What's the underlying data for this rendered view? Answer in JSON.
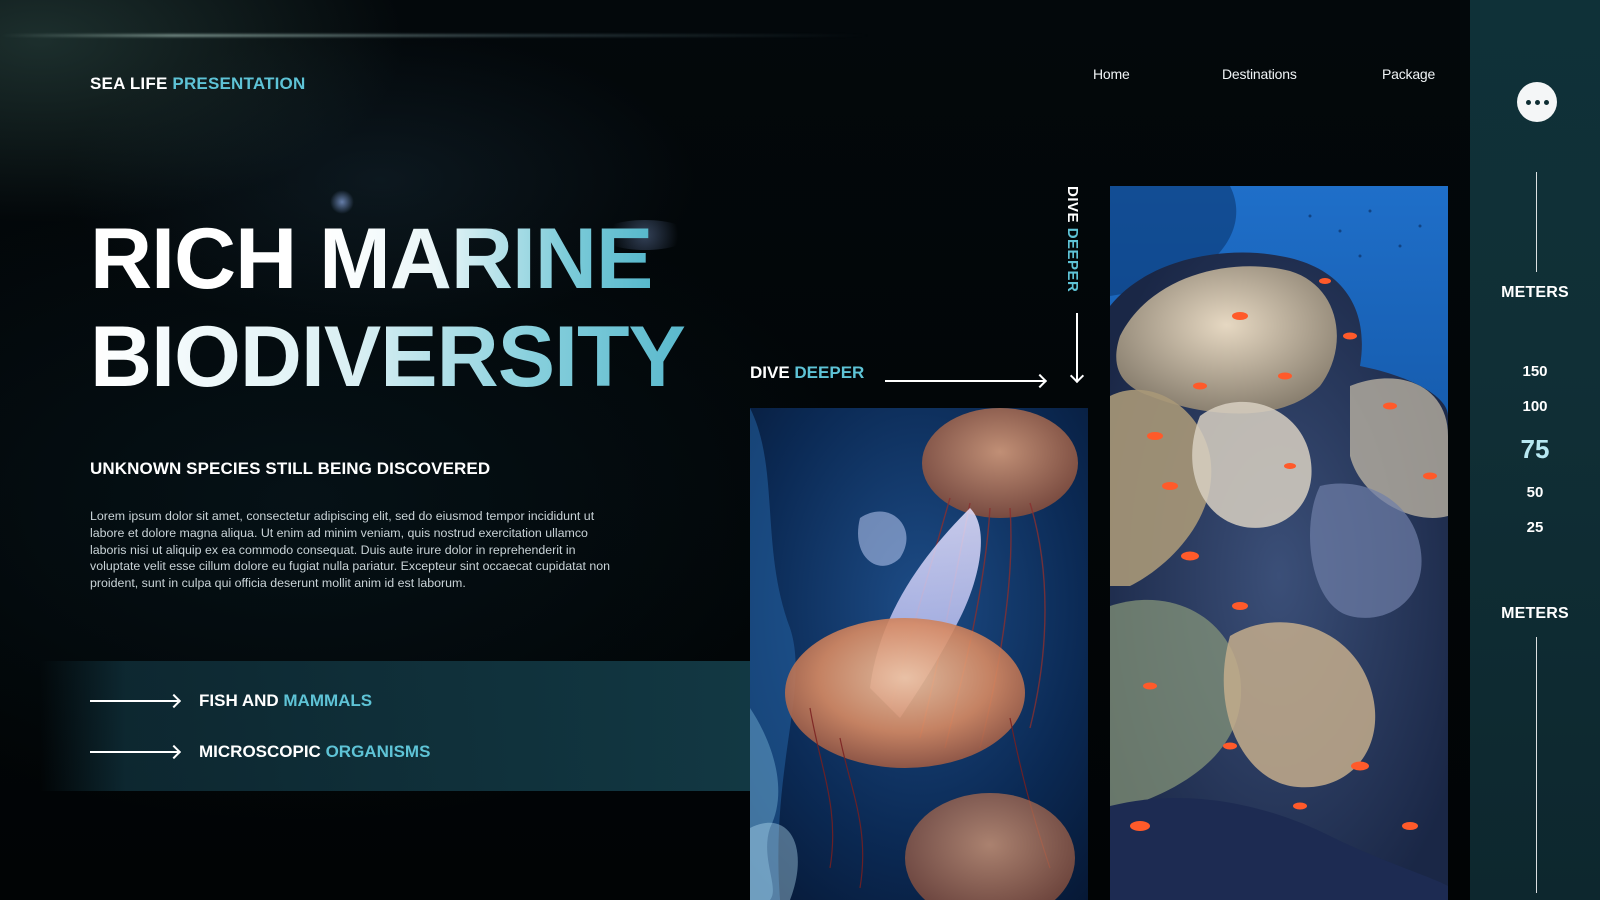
{
  "brand": {
    "part1": "SEA LIFE ",
    "part2": "PRESENTATION"
  },
  "nav": {
    "items": [
      "Home",
      "Destinations",
      "Package"
    ]
  },
  "hero": {
    "line1_a": "RICH ",
    "line1_b": "MARINE",
    "line2": "BIODIVERSITY",
    "subtitle": "UNKNOWN SPECIES STILL BEING DISCOVERED",
    "body": "Lorem ipsum dolor sit amet, consectetur adipiscing elit, sed do eiusmod tempor incididunt ut labore et dolore magna aliqua. Ut enim ad minim veniam, quis nostrud exercitation ullamco laboris nisi ut aliquip ex ea commodo consequat. Duis aute irure dolor in reprehenderit in voluptate velit esse cillum dolore eu fugiat nulla pariatur. Excepteur sint occaecat cupidatat non proident, sunt in culpa qui officia deserunt mollit anim id est laborum."
  },
  "links": [
    {
      "part1": "FISH AND ",
      "part2": "MAMMALS"
    },
    {
      "part1": "MICROSCOPIC ",
      "part2": "ORGANISMS"
    }
  ],
  "dive": {
    "part1": "DIVE ",
    "part2": "DEEPER",
    "vertical_part1": "DIVE ",
    "vertical_part2": "DEEPER"
  },
  "photos": {
    "left": "jellyfish",
    "right": "coral reef with orange fish"
  },
  "sidebar": {
    "menu_icon": "more-horizontal-icon",
    "top_label": "METERS",
    "bottom_label": "METERS",
    "depths": [
      "150",
      "100",
      "75",
      "50",
      "25"
    ],
    "active_depth": "75"
  },
  "colors": {
    "accent": "#5ec3d6",
    "background": "#020608",
    "sidebar": "#0f3138",
    "band": "#123843"
  }
}
